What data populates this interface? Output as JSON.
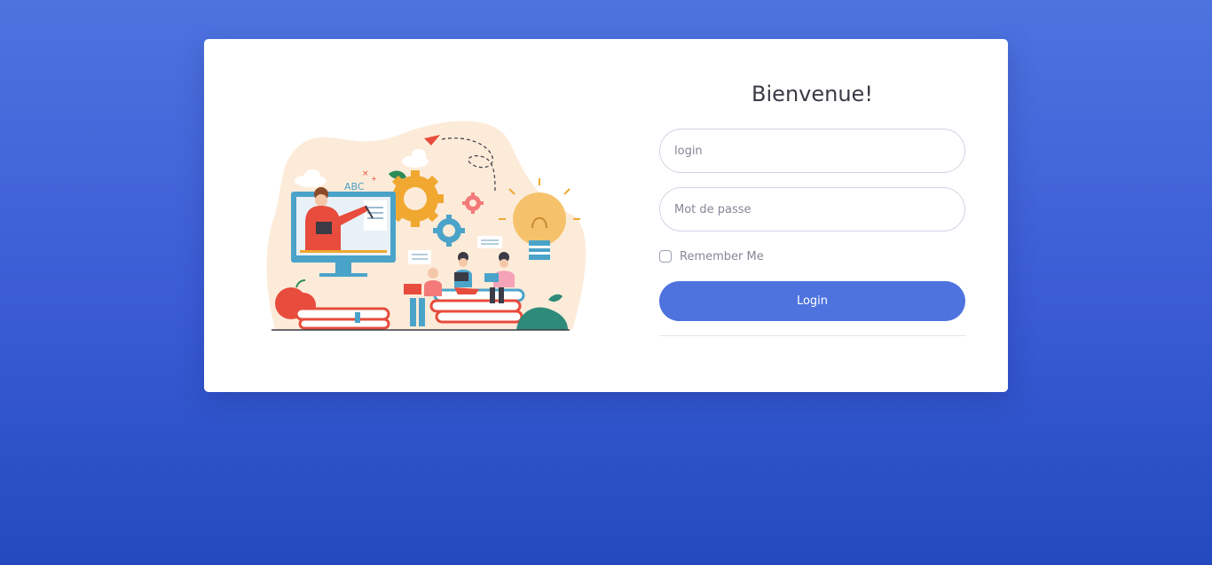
{
  "login_card": {
    "title": "Bienvenue!",
    "login_placeholder": "login",
    "password_placeholder": "Mot de passe",
    "remember_label": "Remember Me",
    "remember_checked": false,
    "submit_label": "Login"
  },
  "illustration": {
    "board_text": "ABC",
    "description_icon": "online-education-illustration"
  },
  "colors": {
    "background_top": "#4e73df",
    "background_bottom": "#224abe",
    "primary": "#4e73df",
    "card": "#ffffff"
  }
}
